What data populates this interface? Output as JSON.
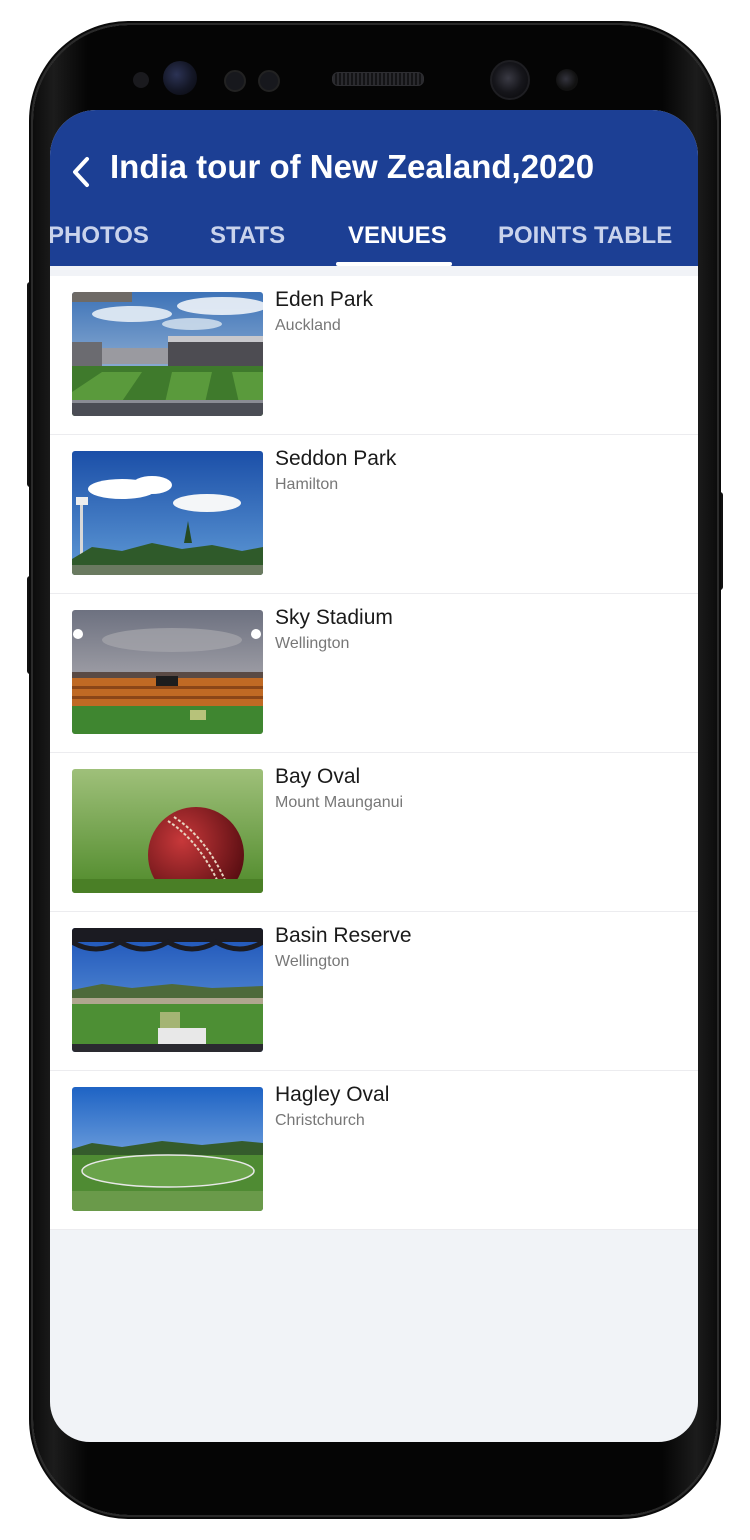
{
  "header": {
    "title": "India tour of New Zealand,2020",
    "back_icon": "chevron-left-icon",
    "background": "#1c3f94"
  },
  "tabs": [
    {
      "label": "PHOTOS",
      "active": false
    },
    {
      "label": "STATS",
      "active": false
    },
    {
      "label": "VENUES",
      "active": true
    },
    {
      "label": "POINTS TABLE",
      "active": false
    }
  ],
  "venues": [
    {
      "name": "Eden Park",
      "city": "Auckland"
    },
    {
      "name": "Seddon Park",
      "city": "Hamilton"
    },
    {
      "name": "Sky Stadium",
      "city": "Wellington"
    },
    {
      "name": "Bay Oval",
      "city": "Mount Maunganui"
    },
    {
      "name": "Basin Reserve",
      "city": "Wellington"
    },
    {
      "name": "Hagley Oval",
      "city": "Christchurch"
    }
  ]
}
